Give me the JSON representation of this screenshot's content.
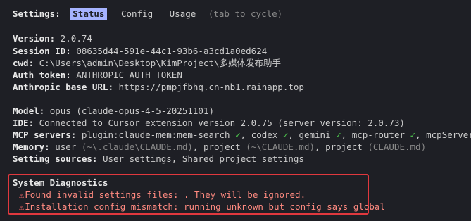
{
  "header": {
    "settings_label": "Settings:",
    "tabs": [
      {
        "label": "Status",
        "active": true
      },
      {
        "label": "Config",
        "active": false
      },
      {
        "label": "Usage",
        "active": false
      }
    ],
    "hint": "(tab to cycle)"
  },
  "status": {
    "version": {
      "label": "Version:",
      "value": "2.0.74"
    },
    "session_id": {
      "label": "Session ID:",
      "value": "08635d44-591e-44c1-93b6-a3cd1a0ed624"
    },
    "cwd": {
      "label": "cwd:",
      "value": "C:\\Users\\admin\\Desktop\\KimProject\\多媒体发布助手"
    },
    "auth_token": {
      "label": "Auth token:",
      "value": "ANTHROPIC_AUTH_TOKEN"
    },
    "base_url": {
      "label": "Anthropic base URL:",
      "value": "https://pmpjfbhq.cn-nb1.rainapp.top"
    },
    "model": {
      "label": "Model:",
      "value": "opus (claude-opus-4-5-20251101)"
    },
    "ide": {
      "label": "IDE:",
      "value": "Connected to Cursor extension version 2.0.75 (server version: 2.0.73)"
    },
    "mcp": {
      "label": "MCP servers:",
      "servers": [
        "plugin:claude-mem:mem-search",
        "codex",
        "gemini",
        "mcp-router",
        "mcpServers"
      ],
      "check": "✓"
    },
    "memory": {
      "label": "Memory:",
      "user": "user",
      "user_path": "(~\\.claude\\CLAUDE.md)",
      "project1": "project",
      "project1_path": "(~\\CLAUDE.md)",
      "project2": "project",
      "project2_path": "(CLAUDE.md)"
    },
    "setting_sources": {
      "label": "Setting sources:",
      "value": "User settings, Shared project settings"
    }
  },
  "diagnostics": {
    "title": "System Diagnostics",
    "warning_icon": "warning-triangle-icon",
    "items": [
      "Found invalid settings files: . They will be ignored.",
      "Installation config mismatch: running unknown but config says global"
    ],
    "colors": {
      "border": "#e0383e",
      "warning": "#ff6b6b"
    }
  },
  "colors": {
    "background": "#1e1f25",
    "active_tab": "#a6b3ff",
    "check": "#4ec94e"
  }
}
